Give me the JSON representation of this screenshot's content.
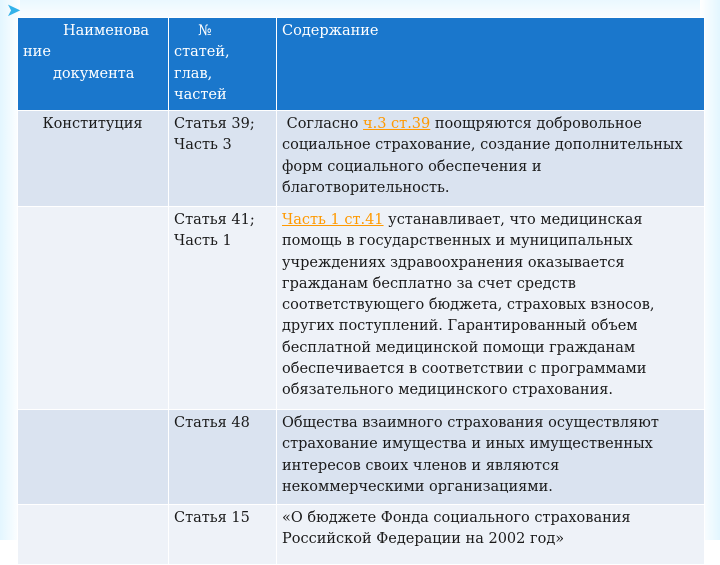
{
  "table": {
    "headers": {
      "name_l1": "Наименова",
      "name_l2": "ние",
      "name_l3": "документа",
      "num_l1": "№",
      "num_l2": "статей,",
      "num_l3": "глав,",
      "num_l4": "частей",
      "content": "Содержание"
    },
    "rows": [
      {
        "document": "Конституция",
        "article_l1": "Статья 39;",
        "article_l2": "Часть 3",
        "content_prefix": "Согласно",
        "content_link": "ч.3 ст.39",
        "content_suffix": "поощряются добровольное социальное страхование, создание дополнительных форм социального обеспечения и благотворительность."
      },
      {
        "document": "",
        "article_l1": "Статья 41;",
        "article_l2": "Часть 1",
        "content_prefix": "",
        "content_link": "Часть 1 ст.41",
        "content_suffix": "устанавливает, что медицинская помощь в государственных и муниципальных учреждениях здравоохранения оказывается гражданам бесплатно за счет средств соответствующего бюджета, страховых взносов, других поступлений. Гарантированный объем бесплатной медицинской помощи гражданам обеспечивается в соответствии с программами обязательного медицинского страхования."
      },
      {
        "document": "",
        "article_l1": "Статья 48",
        "article_l2": "",
        "content_prefix": "",
        "content_link": "",
        "content_suffix": "Общества взаимного страхования осуществляют страхование имущества и иных имущественных интересов своих членов и являются некоммерческими организациями."
      },
      {
        "document": "",
        "article_l1": "Статья 15",
        "article_l2": "",
        "content_prefix": "",
        "content_link": "",
        "content_suffix": "«О бюджете Фонда социального страхования Российской Федерации на 2002 год»"
      }
    ]
  },
  "colors": {
    "header_bg": "#1a77cc",
    "row_odd_bg": "#dae3f0",
    "row_even_bg": "#eef2f8",
    "link": "#ff9900",
    "frame_tint": "#e3f6ff"
  }
}
